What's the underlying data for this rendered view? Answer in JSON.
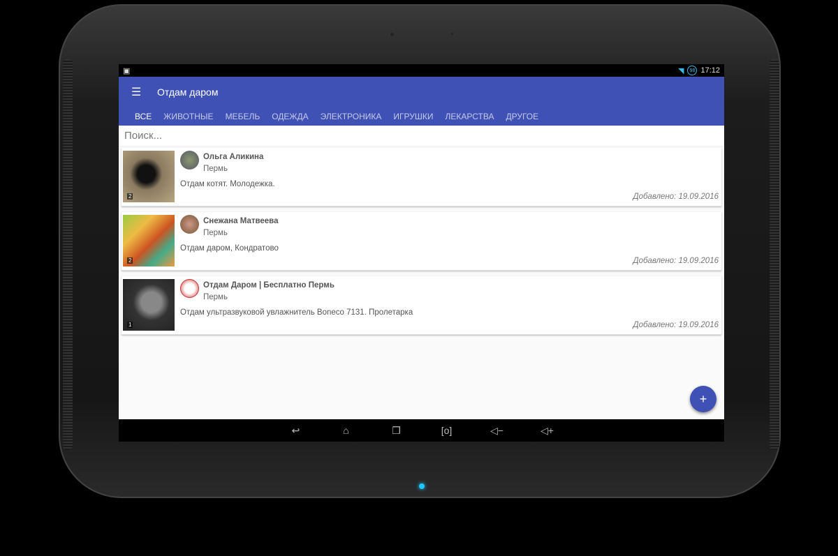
{
  "status": {
    "time": "17:12",
    "battery": "98"
  },
  "app": {
    "title": "Отдам даром"
  },
  "tabs": [
    "ВСЕ",
    "ЖИВОТНЫЕ",
    "МЕБЕЛЬ",
    "ОДЕЖДА",
    "ЭЛЕКТРОНИКА",
    "ИГРУШКИ",
    "ЛЕКАРСТВА",
    "ДРУГОЕ"
  ],
  "search": {
    "placeholder": "Поиск..."
  },
  "posts": [
    {
      "author": "Ольга Аликина",
      "city": "Пермь",
      "text": "Отдам котят. Молодежка.",
      "date": "Добавлено: 19.09.2016",
      "photos": "2"
    },
    {
      "author": "Снежана Матвеева",
      "city": "Пермь",
      "text": "Отдам даром, Кондратово",
      "date": "Добавлено: 19.09.2016",
      "photos": "2"
    },
    {
      "author": "Отдам Даром | Бесплатно Пермь",
      "city": "Пермь",
      "text": "Отдам ультразвуковой увлажнитель Boneco 7131. Пролетарка",
      "date": "Добавлено: 19.09.2016",
      "photos": "1"
    }
  ],
  "fab": "+",
  "colors": {
    "primary": "#3f51b5"
  }
}
